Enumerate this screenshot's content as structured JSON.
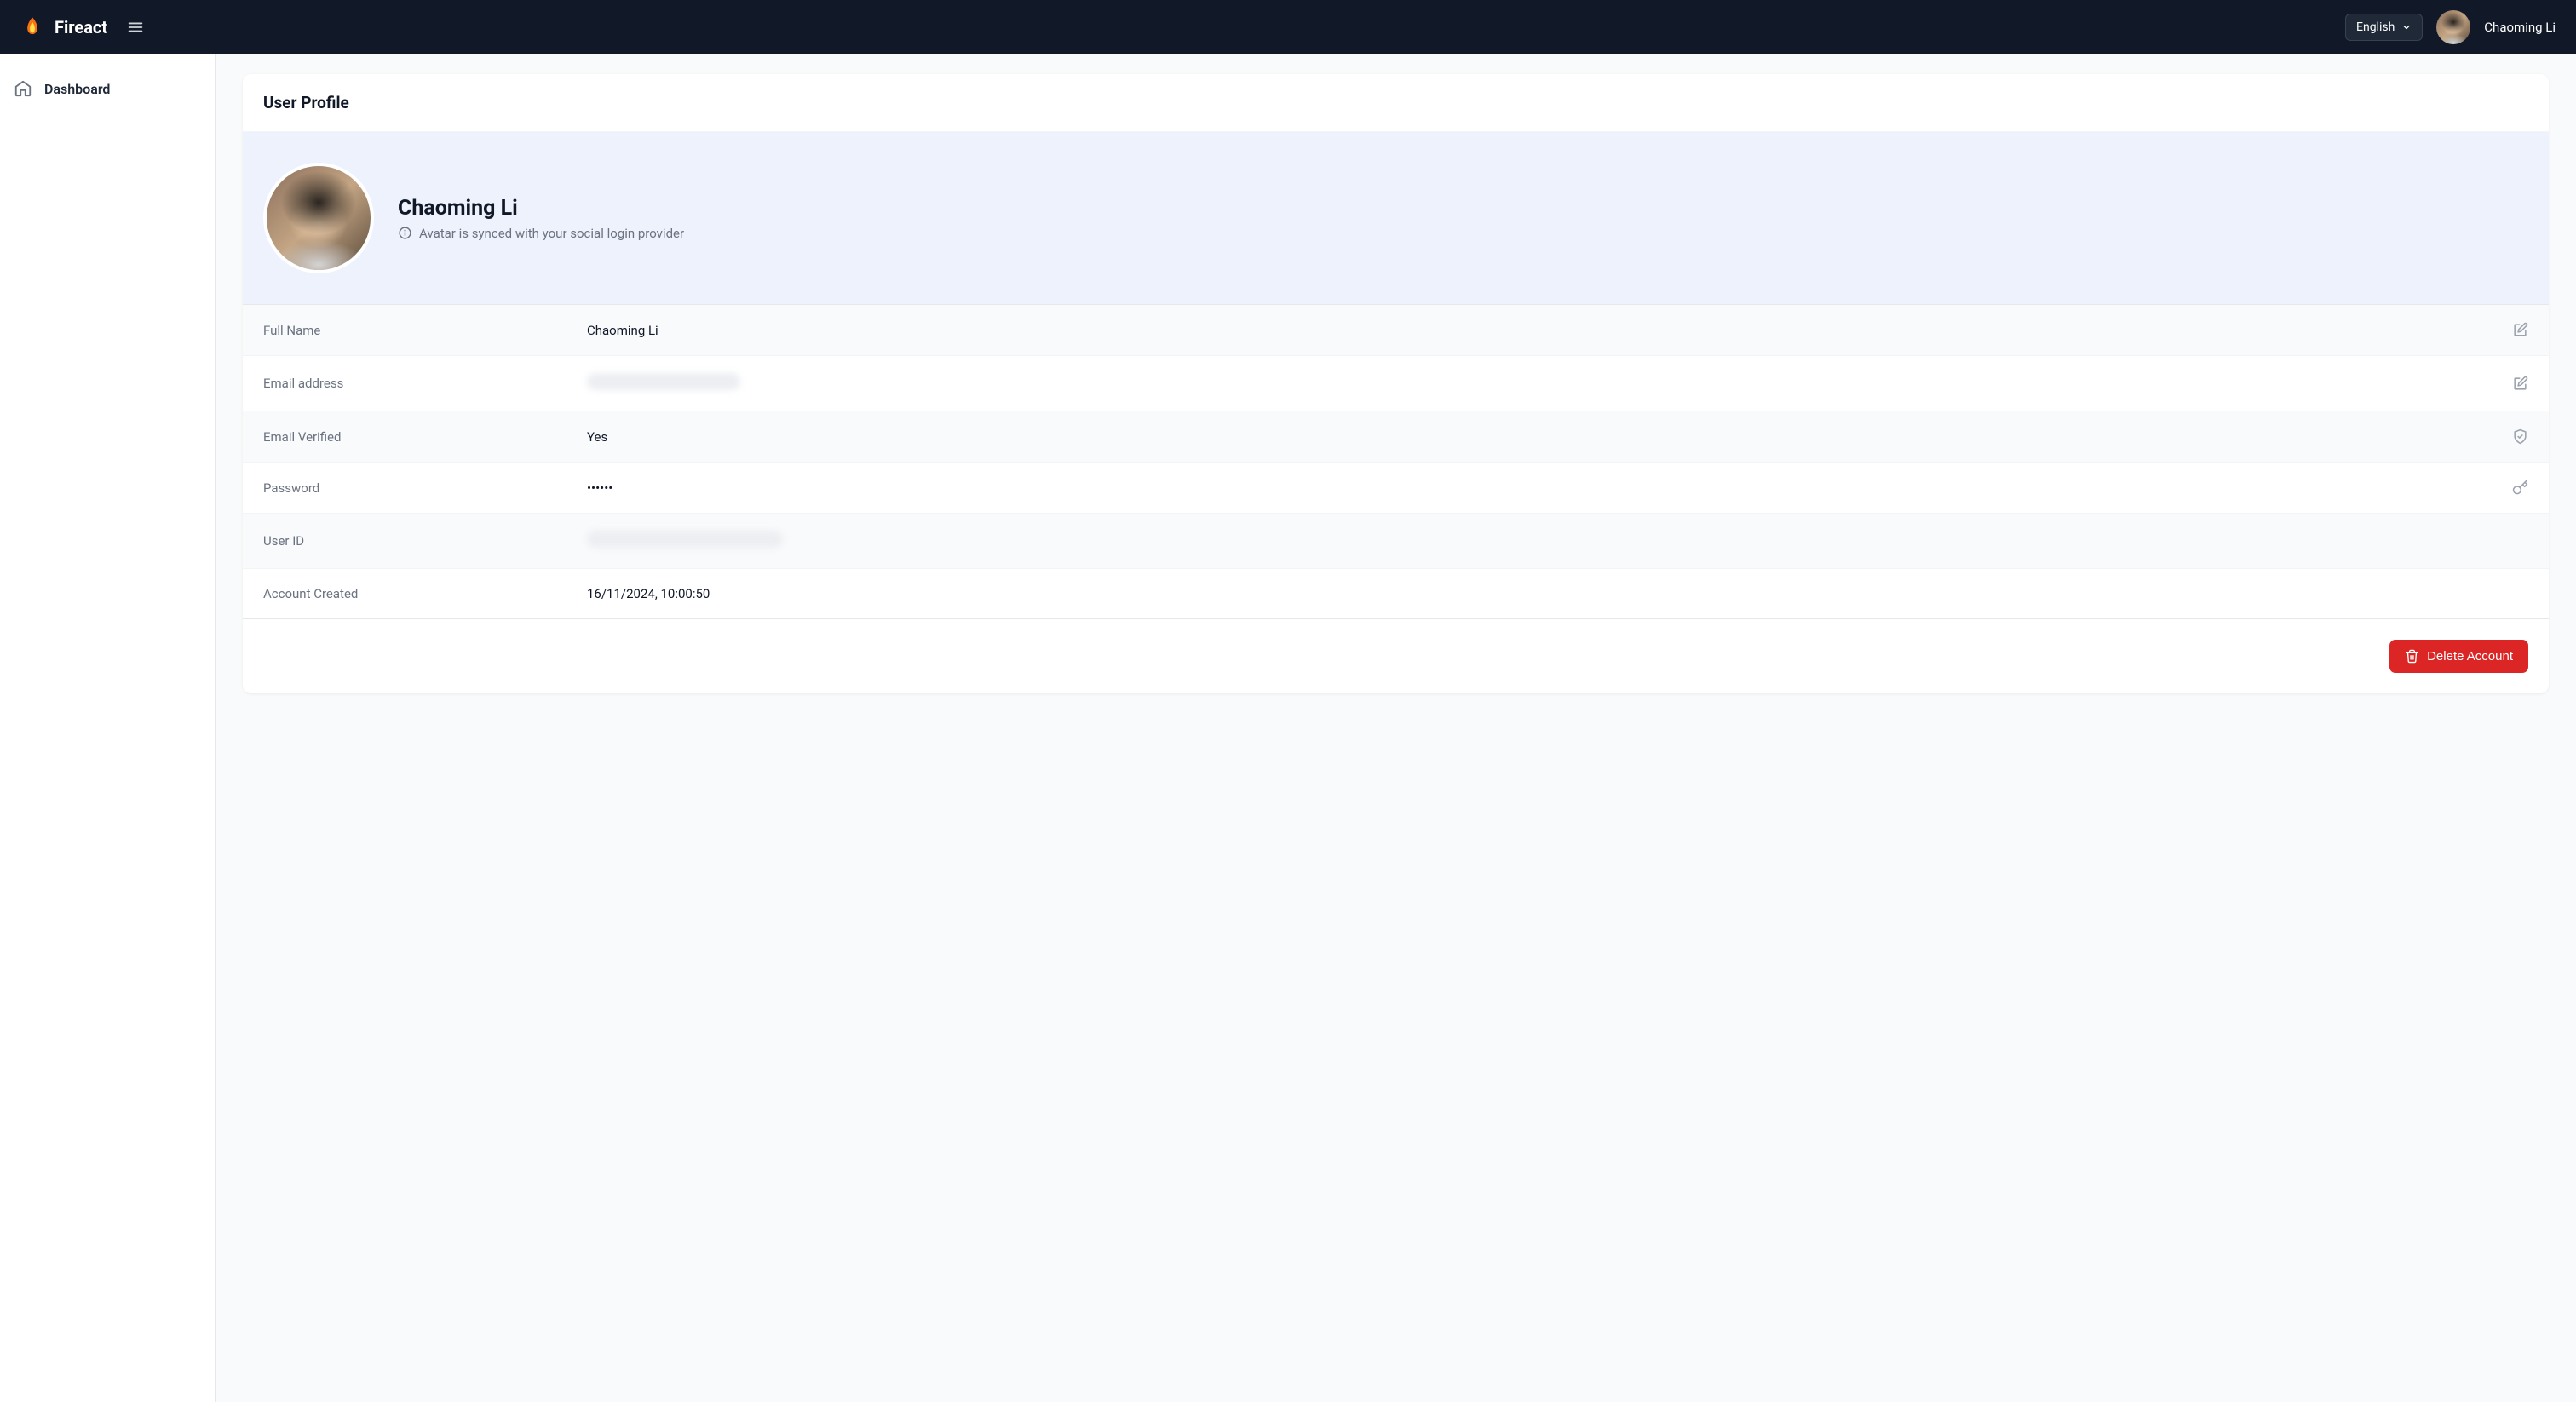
{
  "header": {
    "brand": "Fireact",
    "language": "English",
    "username": "Chaoming Li"
  },
  "sidebar": {
    "items": [
      {
        "label": "Dashboard"
      }
    ]
  },
  "profile": {
    "card_title": "User Profile",
    "display_name": "Chaoming Li",
    "avatar_note": "Avatar is synced with your social login provider",
    "rows": {
      "full_name_label": "Full Name",
      "full_name_value": "Chaoming Li",
      "email_label": "Email address",
      "email_value": "",
      "email_verified_label": "Email Verified",
      "email_verified_value": "Yes",
      "password_label": "Password",
      "password_value": "••••••",
      "user_id_label": "User ID",
      "user_id_value": "",
      "created_label": "Account Created",
      "created_value": "16/11/2024, 10:00:50"
    },
    "delete_button": "Delete Account"
  }
}
